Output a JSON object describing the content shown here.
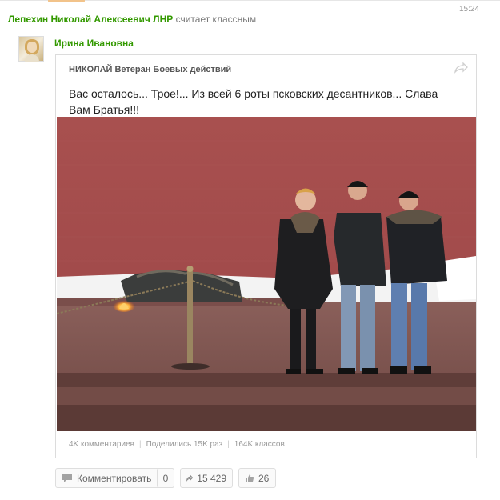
{
  "feed": {
    "time": "15:24",
    "actor_name": "Лепехин Николай Алексеевич ЛНР",
    "action_text": "считает классным",
    "poster_name": "Ирина Ивановна"
  },
  "post": {
    "author_name": "НИКОЛАЙ Ветеран Боевых действий",
    "text": "Вас осталось... Трое!... Из всей 6 роты псковских десантников... Слава Вам Братья!!!",
    "stats": {
      "comments": "4K комментариев",
      "shares": "Поделились 15K раз",
      "likes": "164K классов"
    }
  },
  "actions": {
    "comment_label": "Комментировать",
    "comment_count": "0",
    "share_count": "15 429",
    "like_count": "26"
  },
  "colors": {
    "name_green": "#339900",
    "wall_red": "#a34c4a"
  },
  "icons": [
    "share-arrow-icon",
    "comment-bubble-icon",
    "reshare-icon",
    "thumbs-up-icon"
  ]
}
